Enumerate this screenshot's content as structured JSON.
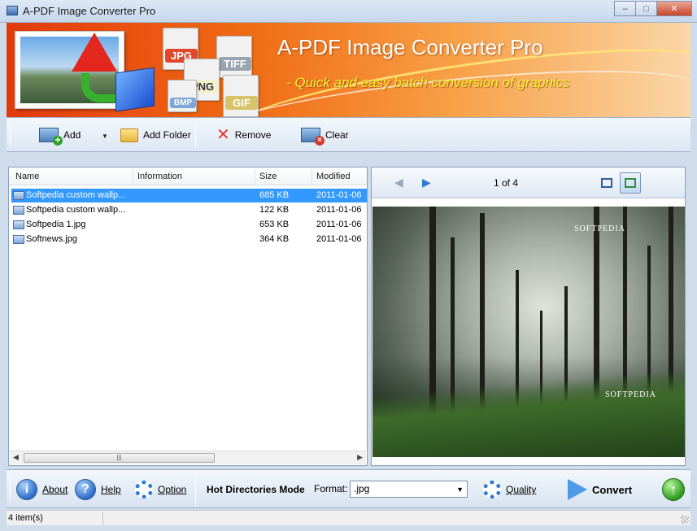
{
  "window": {
    "title": "A-PDF Image Converter Pro",
    "controls": {
      "minimize": "–",
      "maximize": "□",
      "close": "✕"
    }
  },
  "banner": {
    "title": "A-PDF Image Converter Pro",
    "subtitle": "- Quick and easy batch conversion of graphics",
    "format_badges": [
      "JPG",
      "TIFF",
      "PNG",
      "GIF",
      "BMP"
    ]
  },
  "toolbar": {
    "add_label": "Add",
    "add_folder_label": "Add Folder",
    "remove_label": "Remove",
    "clear_label": "Clear"
  },
  "file_list": {
    "columns": [
      "Name",
      "Information",
      "Size",
      "Modified"
    ],
    "rows": [
      {
        "name": "Softpedia custom wallp...",
        "info": "",
        "size": "685 KB",
        "modified": "2011-01-06",
        "selected": true
      },
      {
        "name": "Softpedia custom wallp...",
        "info": "",
        "size": "122 KB",
        "modified": "2011-01-06",
        "selected": false
      },
      {
        "name": "Softpedia 1.jpg",
        "info": "",
        "size": "653 KB",
        "modified": "2011-01-06",
        "selected": false
      },
      {
        "name": "Softnews.jpg",
        "info": "",
        "size": "364 KB",
        "modified": "2011-01-06",
        "selected": false
      }
    ]
  },
  "preview": {
    "page_indicator": "1 of 4",
    "watermark_top": "SOFTPEDIA",
    "watermark_bottom": "SOFTPEDIA"
  },
  "bottom_bar": {
    "about_label": "About",
    "help_label": "Help",
    "option_label": "Option",
    "hot_directories_label": "Hot Directories Mode",
    "format_label": "Format:",
    "format_value": ".jpg",
    "quality_label": "Quality",
    "convert_label": "Convert"
  },
  "status": {
    "item_count": "4 item(s)"
  },
  "colors": {
    "selection": "#3399ff",
    "banner_start": "#e23a0c",
    "banner_end": "#fbd6a8",
    "subtitle": "#f7f233"
  }
}
